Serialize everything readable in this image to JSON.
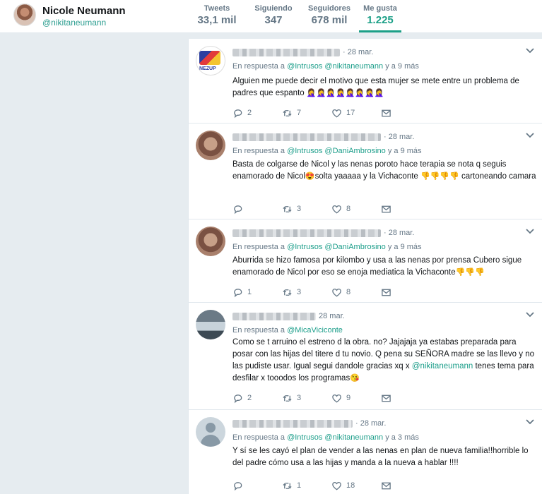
{
  "profile": {
    "name": "Nicole Neumann",
    "handle": "@nikitaneumann"
  },
  "stats": [
    {
      "label": "Tweets",
      "value": "33,1 mil"
    },
    {
      "label": "Siguiendo",
      "value": "347"
    },
    {
      "label": "Seguidores",
      "value": "678 mil"
    },
    {
      "label": "Me gusta",
      "value": "1.225"
    }
  ],
  "reply_prefix": "En respuesta a",
  "tweets": [
    {
      "date": "· 28 mar.",
      "reply_to": [
        "@Intrusos",
        "@nikitaneumann"
      ],
      "reply_more": "y a 9 más",
      "text": "Alguien me puede decir el motivo que esta mujer se mete entre un problema de padres que espanto",
      "emojis": "🤦‍♀️🤦‍♀️🤦‍♀️🤦‍♀️🤦‍♀️🤦‍♀️🤦‍♀️🤦‍♀️",
      "replies": "2",
      "retweets": "7",
      "likes": "17"
    },
    {
      "date": "· 28 mar.",
      "reply_to": [
        "@Intrusos",
        "@DaniAmbrosino"
      ],
      "reply_more": "y a 9 más",
      "text_a": "Basta de colgarse de Nicol y las nenas poroto hace terapia se nota q seguis enamorado de Nicol",
      "emoji_a": "😍",
      "text_b": "solta yaaaaa y la Vichaconte",
      "emoji_b": "👎👎👎👎",
      "text_c": "cartoneando camara",
      "replies": "",
      "retweets": "3",
      "likes": "8"
    },
    {
      "date": "· 28 mar.",
      "reply_to": [
        "@Intrusos",
        "@DaniAmbrosino"
      ],
      "reply_more": "y a 9 más",
      "text": "Aburrida se hizo famosa por kilombo y usa a las nenas por prensa Cubero sigue enamorado de Nicol por eso se enoja mediatica la Vichaconte",
      "emojis": "👎👎👎",
      "replies": "1",
      "retweets": "3",
      "likes": "8"
    },
    {
      "date": "28 mar.",
      "reply_to": [
        "@MicaViciconte"
      ],
      "reply_more": "",
      "text_a": "Como se t arruino el estreno d la obra. no? Jajajaja ya estabas preparada para posar con las hijas del titere d tu novio. Q pena su SEÑORA madre se las llevo y no las pudiste usar. Igual segui dandole gracias xq x ",
      "mention": "@nikitaneumann",
      "text_b": " tenes tema para desfilar x tooodos los programas",
      "emojis": "😘",
      "replies": "2",
      "retweets": "3",
      "likes": "9"
    },
    {
      "date": "· 28 mar.",
      "reply_to": [
        "@Intrusos",
        "@nikitaneumann"
      ],
      "reply_more": "y a 3 más",
      "text": "Y sí se les cayó el plan de vender  a las nenas en plan  de nueva familia!!horrible lo del padre cómo usa a las hijas y manda a la nueva a hablar !!!!",
      "replies": "",
      "retweets": "1",
      "likes": "18"
    }
  ],
  "colors": {
    "accent": "#1da088",
    "mention": "#1c9e8a",
    "muted": "#657786",
    "background": "#e6ecf0"
  },
  "icons": [
    "reply-icon",
    "retweet-icon",
    "like-icon",
    "message-icon",
    "chevron-down-icon"
  ]
}
